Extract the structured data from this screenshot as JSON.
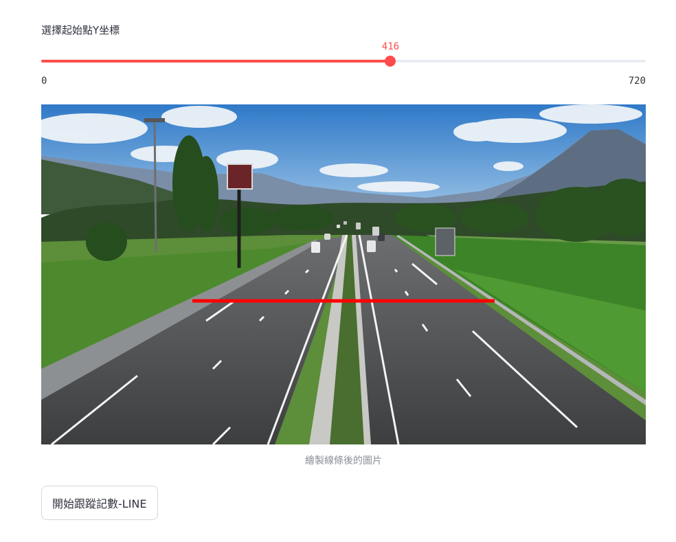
{
  "slider": {
    "label": "選擇起始點Y坐標",
    "value": 416,
    "min": 0,
    "max": 720,
    "min_label": "0",
    "max_label": "720",
    "accent_color": "#ff4b4b"
  },
  "image": {
    "subject": "highway overpass view with a red horizontal counting line",
    "line_color": "#ff0000",
    "caption": "繪製線條後的圖片"
  },
  "button": {
    "label": "開始跟蹤記數-LINE"
  }
}
